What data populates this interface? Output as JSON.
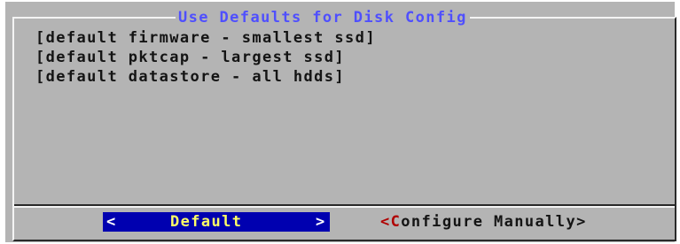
{
  "dialog": {
    "title": "Use Defaults for Disk Config",
    "lines": [
      "[default firmware - smallest ssd]",
      "[default pktcap - largest ssd]",
      "[default datastore - all hdds]"
    ]
  },
  "buttons": {
    "default": {
      "left_bracket": "<",
      "label": "Default",
      "right_bracket": ">"
    },
    "manual": {
      "left_bracket": "<",
      "hotkey": "C",
      "rest": "onfigure Manually",
      "right_bracket": ">"
    }
  },
  "colors": {
    "dialog_bg": "#b4b4b4",
    "title": "#4f4fff",
    "selected_button_bg": "#0000b0",
    "selected_label": "#ffff66",
    "hotkey": "#b00000"
  }
}
